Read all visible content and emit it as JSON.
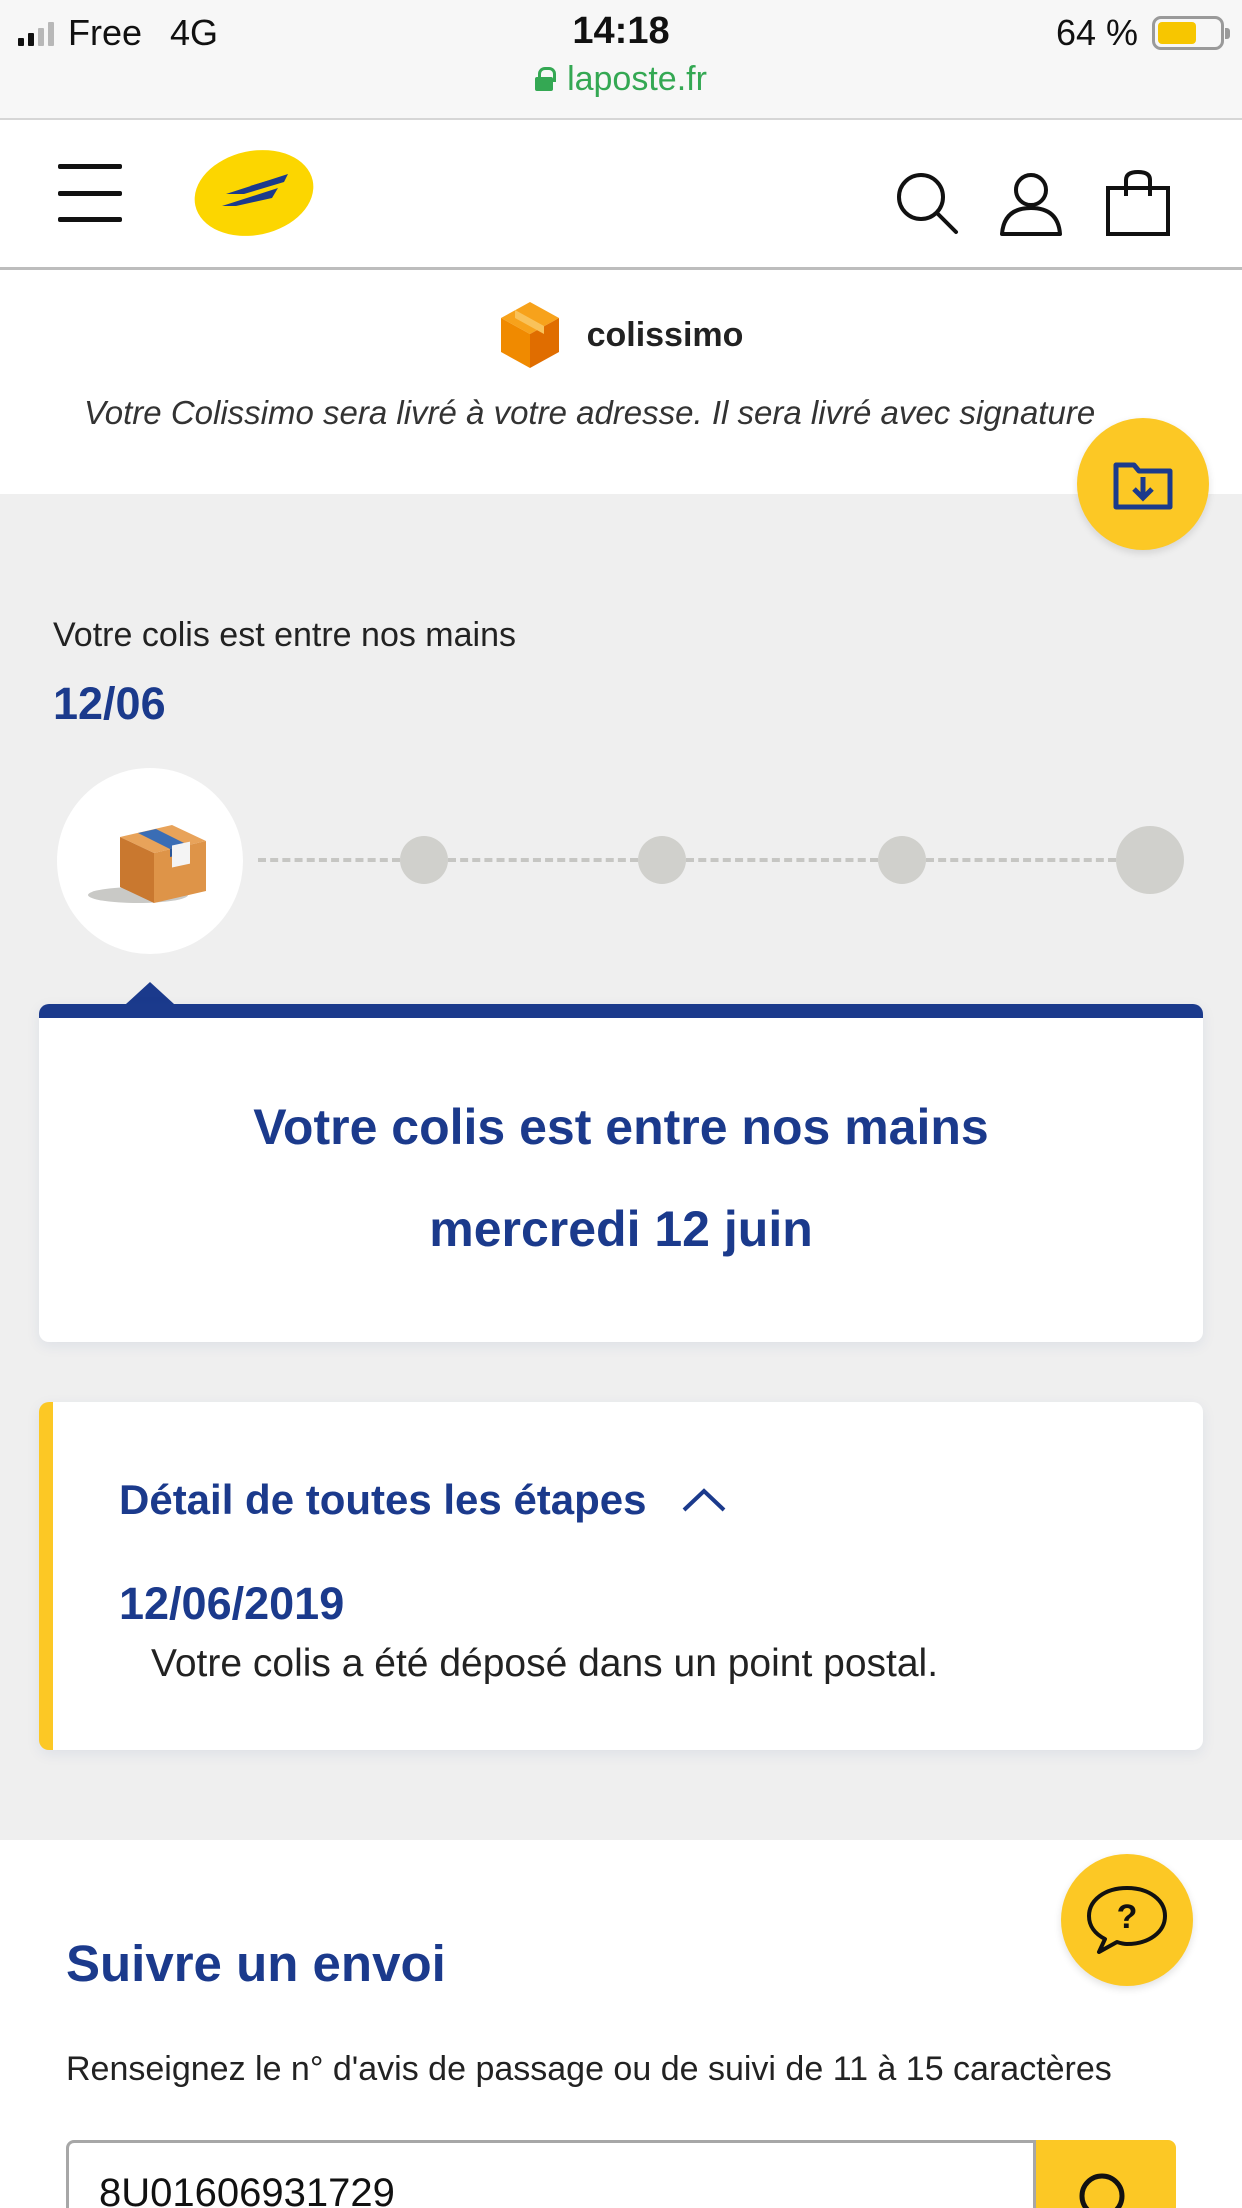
{
  "status_bar": {
    "carrier": "Free",
    "network": "4G",
    "time": "14:18",
    "battery": "64 %",
    "battery_level": 0.64,
    "url": "laposte.fr"
  },
  "header": {
    "icons": [
      "menu-icon",
      "la-poste-logo",
      "search-icon",
      "account-icon",
      "cart-icon"
    ]
  },
  "service": {
    "brand": "colissimo",
    "description": "Votre Colissimo sera livré à votre adresse. Il sera livré avec signature"
  },
  "tracking_status": {
    "label": "Votre colis est entre nos mains",
    "date_short": "12/06",
    "steps_total": 5,
    "current_step": 1
  },
  "status_card": {
    "title": "Votre colis est entre nos mains",
    "subtitle": "mercredi 12 juin"
  },
  "details": {
    "toggle_label": "Détail de toutes les étapes",
    "events": [
      {
        "date": "12/06/2019",
        "text": "Votre colis a été déposé dans un point postal."
      }
    ]
  },
  "track_form": {
    "title": "Suivre un envoi",
    "help_text": "Renseignez le n° d'avis de passage ou de suivi de 11 à 15 caractères",
    "input_value": "8U01606931729"
  },
  "colors": {
    "brand_blue": "#1b3a8c",
    "brand_yellow": "#fcc825",
    "gray_bg": "#efefef"
  }
}
